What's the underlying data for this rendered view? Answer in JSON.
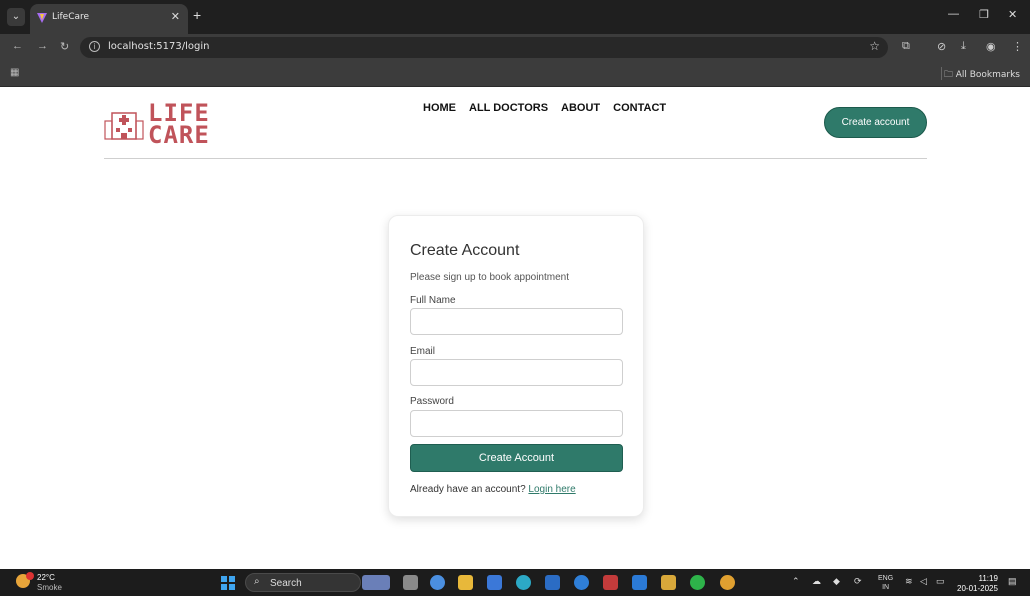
{
  "browser": {
    "tab_title": "LifeCare",
    "url": "localhost:5173/login",
    "all_bookmarks": "All Bookmarks"
  },
  "header": {
    "logo_line1": "LIFE",
    "logo_line2": "CARE",
    "nav": [
      "HOME",
      "ALL DOCTORS",
      "ABOUT",
      "CONTACT"
    ],
    "create_account_button": "Create account",
    "accent_color": "#2f7a6a",
    "logo_color": "#c0535a"
  },
  "form": {
    "title": "Create Account",
    "subtitle": "Please sign up to book appointment",
    "fields": [
      {
        "label": "Full Name",
        "value": ""
      },
      {
        "label": "Email",
        "value": ""
      },
      {
        "label": "Password",
        "value": ""
      }
    ],
    "submit": "Create Account",
    "login_prompt": "Already have an account?",
    "login_link": "Login here"
  },
  "taskbar": {
    "temperature": "22°C",
    "weather": "Smoke",
    "search": "Search",
    "lang_top": "ENG",
    "lang_bottom": "IN",
    "time": "11:19",
    "date": "20-01-2025"
  }
}
